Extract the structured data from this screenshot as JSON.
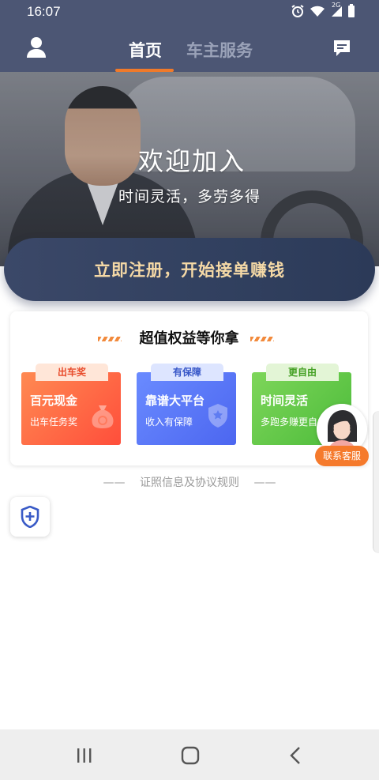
{
  "status_bar": {
    "time": "16:07",
    "network": "2G"
  },
  "header": {
    "tabs": [
      {
        "label": "首页",
        "active": true
      },
      {
        "label": "车主服务",
        "active": false
      }
    ],
    "icons": {
      "left": "user-profile-icon",
      "right": "message-icon"
    },
    "colors": {
      "background": "#4c5674",
      "active_tab": "#ffffff",
      "inactive_tab": "#9aa2b8",
      "underline": "#f07a2a"
    }
  },
  "hero": {
    "title": "欢迎加入",
    "subtitle": "时间灵活，多劳多得"
  },
  "register_button": {
    "label": "立即注册，开始接单赚钱",
    "text_color": "#f5d9a6"
  },
  "benefits": {
    "title": "超值权益等你拿",
    "items": [
      {
        "tag": "出车奖",
        "name": "百元现金",
        "desc": "出车任务奖",
        "icon": "money-bag-icon"
      },
      {
        "tag": "有保障",
        "name": "靠谱大平台",
        "desc": "收入有保障",
        "icon": "shield-star-icon"
      },
      {
        "tag": "更自由",
        "name": "时间灵活",
        "desc": "多跑多赚更自由",
        "icon": "clock-icon"
      }
    ]
  },
  "license_link": {
    "label": "证照信息及协议规则",
    "dash": "——"
  },
  "security_button": {
    "icon": "shield-plus-icon"
  },
  "customer_service": {
    "label": "联系客服",
    "icon": "agent-avatar-icon"
  },
  "nav_bar": {
    "icons": [
      "recent-apps-icon",
      "home-icon",
      "back-icon"
    ]
  }
}
